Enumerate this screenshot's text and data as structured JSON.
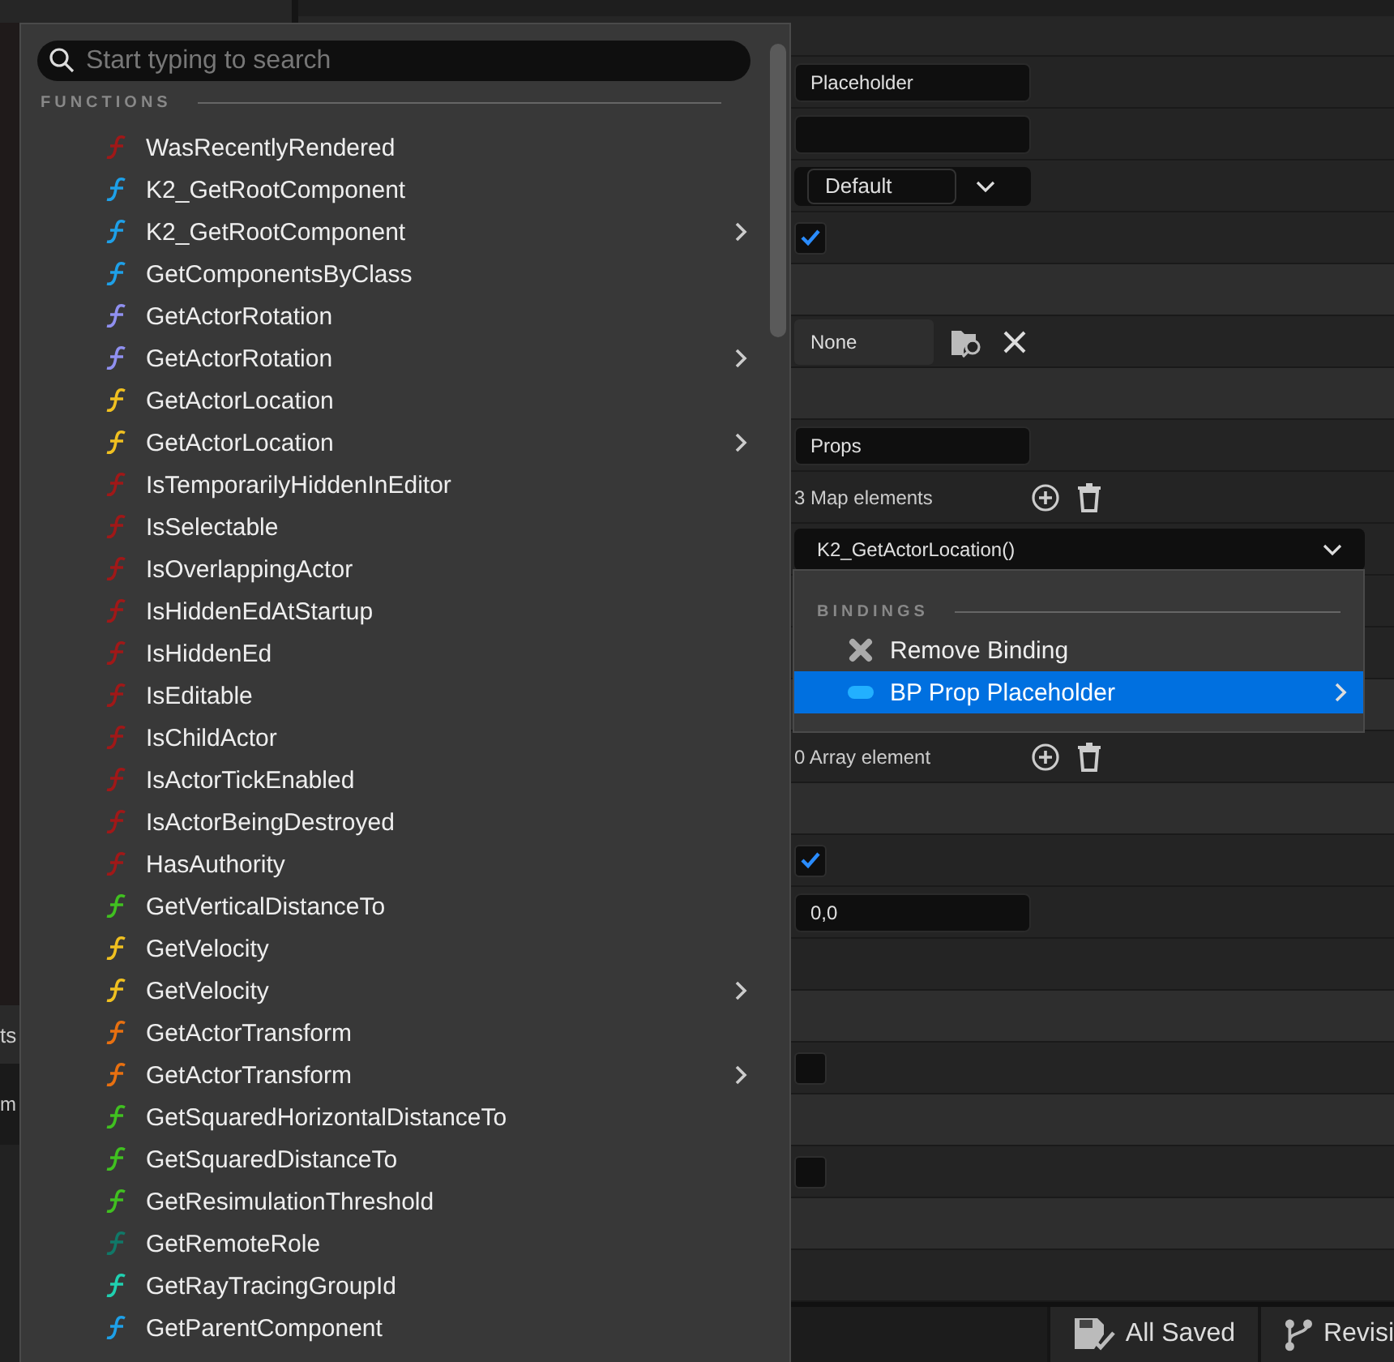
{
  "left_panel": {
    "labels": [
      "ts",
      "m"
    ]
  },
  "details": {
    "rows": [
      {
        "kind": "text_field",
        "value": "Placeholder"
      },
      {
        "kind": "text_field",
        "value": ""
      },
      {
        "kind": "combo",
        "value": "Default"
      },
      {
        "kind": "checkbox",
        "checked": true
      },
      {
        "kind": "category"
      },
      {
        "kind": "asset",
        "value": "None"
      },
      {
        "kind": "category"
      },
      {
        "kind": "text_field",
        "value": "Props"
      },
      {
        "kind": "container",
        "text": "3 Map elements"
      },
      {
        "kind": "binding_combo",
        "value": "K2_GetActorLocation()"
      },
      {
        "kind": "blank"
      },
      {
        "kind": "blank"
      },
      {
        "kind": "category"
      },
      {
        "kind": "container",
        "text": "0 Array element"
      },
      {
        "kind": "category"
      },
      {
        "kind": "checkbox",
        "checked": true
      },
      {
        "kind": "text_field",
        "value": "0,0"
      },
      {
        "kind": "blank"
      },
      {
        "kind": "category"
      },
      {
        "kind": "checkbox",
        "checked": false
      },
      {
        "kind": "category"
      },
      {
        "kind": "checkbox",
        "checked": false
      },
      {
        "kind": "category"
      },
      {
        "kind": "blank"
      }
    ]
  },
  "bindings_menu": {
    "header": "BINDINGS",
    "items": [
      {
        "kind": "remove",
        "label": "Remove Binding",
        "selected": false,
        "has_submenu": false
      },
      {
        "kind": "binding",
        "label": "BP Prop Placeholder",
        "selected": true,
        "has_submenu": true
      }
    ]
  },
  "status_bar": {
    "buttons": [
      {
        "kind": "save",
        "label": "All Saved"
      },
      {
        "kind": "revision",
        "label": "Revisi"
      }
    ]
  },
  "function_picker": {
    "search": {
      "placeholder": "Start typing to search"
    },
    "section": "FUNCTIONS",
    "items": [
      {
        "label": "WasRecentlyRendered",
        "color": "#a01818",
        "has_submenu": false
      },
      {
        "label": "K2_GetRootComponent",
        "color": "#1ea0e8",
        "has_submenu": false
      },
      {
        "label": "K2_GetRootComponent",
        "color": "#1ea0e8",
        "has_submenu": true
      },
      {
        "label": "GetComponentsByClass",
        "color": "#1ea0e8",
        "has_submenu": false
      },
      {
        "label": "GetActorRotation",
        "color": "#9090f0",
        "has_submenu": false
      },
      {
        "label": "GetActorRotation",
        "color": "#9090f0",
        "has_submenu": true
      },
      {
        "label": "GetActorLocation",
        "color": "#f0c020",
        "has_submenu": false
      },
      {
        "label": "GetActorLocation",
        "color": "#f0c020",
        "has_submenu": true
      },
      {
        "label": "IsTemporarilyHiddenInEditor",
        "color": "#a01818",
        "has_submenu": false
      },
      {
        "label": "IsSelectable",
        "color": "#a01818",
        "has_submenu": false
      },
      {
        "label": "IsOverlappingActor",
        "color": "#a01818",
        "has_submenu": false
      },
      {
        "label": "IsHiddenEdAtStartup",
        "color": "#a01818",
        "has_submenu": false
      },
      {
        "label": "IsHiddenEd",
        "color": "#a01818",
        "has_submenu": false
      },
      {
        "label": "IsEditable",
        "color": "#a01818",
        "has_submenu": false
      },
      {
        "label": "IsChildActor",
        "color": "#a01818",
        "has_submenu": false
      },
      {
        "label": "IsActorTickEnabled",
        "color": "#a01818",
        "has_submenu": false
      },
      {
        "label": "IsActorBeingDestroyed",
        "color": "#a01818",
        "has_submenu": false
      },
      {
        "label": "HasAuthority",
        "color": "#a01818",
        "has_submenu": false
      },
      {
        "label": "GetVerticalDistanceTo",
        "color": "#40c020",
        "has_submenu": false
      },
      {
        "label": "GetVelocity",
        "color": "#f0c020",
        "has_submenu": false
      },
      {
        "label": "GetVelocity",
        "color": "#f0c020",
        "has_submenu": true
      },
      {
        "label": "GetActorTransform",
        "color": "#e87010",
        "has_submenu": false
      },
      {
        "label": "GetActorTransform",
        "color": "#e87010",
        "has_submenu": true
      },
      {
        "label": "GetSquaredHorizontalDistanceTo",
        "color": "#40c020",
        "has_submenu": false
      },
      {
        "label": "GetSquaredDistanceTo",
        "color": "#40c020",
        "has_submenu": false
      },
      {
        "label": "GetResimulationThreshold",
        "color": "#40c020",
        "has_submenu": false
      },
      {
        "label": "GetRemoteRole",
        "color": "#107868",
        "has_submenu": false
      },
      {
        "label": "GetRayTracingGroupId",
        "color": "#20d0b0",
        "has_submenu": false
      },
      {
        "label": "GetParentComponent",
        "color": "#1ea0e8",
        "has_submenu": false
      }
    ]
  }
}
